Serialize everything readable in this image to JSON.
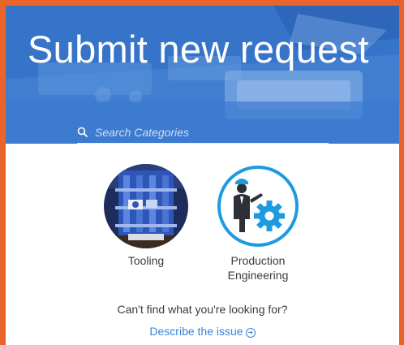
{
  "header": {
    "title": "Submit new request"
  },
  "search": {
    "placeholder": "Search Categories"
  },
  "categories": [
    {
      "label": "Tooling",
      "icon": "tooling-photo"
    },
    {
      "label": "Production Engineering",
      "icon": "engineer-gear-icon"
    }
  ],
  "help": {
    "question": "Can't find what you're looking for?",
    "link_label": "Describe the issue"
  },
  "colors": {
    "accent_border": "#e8642a",
    "hero_blue": "#3a79cf",
    "link_blue": "#3a84d6",
    "icon_ring": "#1e9be0"
  }
}
